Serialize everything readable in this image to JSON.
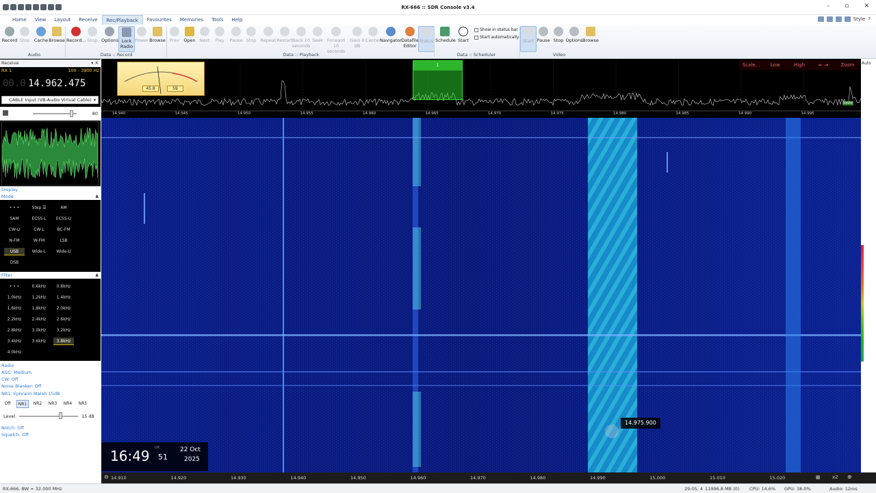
{
  "window": {
    "title": "RX-666 :: SDR Console v3.4",
    "style_label": "Style"
  },
  "menu": [
    "Home",
    "View",
    "Layout",
    "Receive",
    "Rec/Playback",
    "Favourites",
    "Memories",
    "Tools",
    "Help"
  ],
  "ribbon": {
    "audio": {
      "record": "Record",
      "stop": "Stop",
      "cache": "Cache",
      "browse": "Browse",
      "group": "Audio"
    },
    "record": {
      "record": "Record...",
      "stop": "Stop",
      "options": "Options",
      "lock_radio": "Lock Radio",
      "power": "Power",
      "browse": "Browse",
      "group": "Data :: Record"
    },
    "playback": {
      "prev": "Prev",
      "open": "Open",
      "next": "Next",
      "play": "Play",
      "pause": "Pause",
      "stop": "Stop",
      "repeat": "Repeat",
      "restart": "Restart",
      "back10": "Back 10 seconds",
      "seek": "Seek",
      "forward10": "Forward 10 seconds",
      "gain": "Gain 0 dB",
      "center": "Center",
      "navigator": "Navigator",
      "datafile_editor": "Datafile Editor",
      "status": "Status",
      "group": "Data :: Playback"
    },
    "scheduler": {
      "schedule": "Schedule",
      "start": "Start",
      "show_status": "Show in status bar",
      "start_auto": "Start automatically",
      "group": "Data :: Scheduler"
    },
    "video": {
      "start": "Start",
      "pause": "Pause",
      "stop": "Stop",
      "options": "Options",
      "browse": "Browse",
      "group": "Video"
    }
  },
  "receive": {
    "header": "Receive",
    "rx": "RX 1",
    "range": "100 - 3900 Hz",
    "freq_dim": "00.0",
    "freq_main": "14.962.475",
    "source": "CABLE Input (VB-Audio Virtual Cable)",
    "volume": "80"
  },
  "display_section": "Display",
  "mode": {
    "title": "Mode",
    "buttons": [
      "• • •",
      "Step ☰",
      "AM",
      "SAM",
      "ECSS-L",
      "ECSS-U",
      "CW-U",
      "CW-L",
      "BC-FM",
      "N-FM",
      "W-FM",
      "LSB",
      "USB",
      "Wide-L",
      "Wide-U",
      "DSB"
    ],
    "selected": "USB"
  },
  "filter": {
    "title": "Filter",
    "buttons": [
      "• • •",
      "0.6kHz",
      "0.8kHz",
      "1.0kHz",
      "1.2kHz",
      "1.4kHz",
      "1.6kHz",
      "1.8kHz",
      "2.0kHz",
      "2.2kHz",
      "2.4kHz",
      "2.6kHz",
      "2.8kHz",
      "3.0kHz",
      "3.2kHz",
      "3.4kHz",
      "3.6kHz",
      "3.8kHz",
      "4.0kHz"
    ],
    "selected": "3.8kHz"
  },
  "radio": {
    "title": "Radio",
    "agc": "AGC: Medium",
    "cw": "CW: Off",
    "noise_blanker": "Noise Blanker: Off",
    "nr": "NR1: Ephraim Malah 15dB",
    "nr_buttons": [
      "Off",
      "NR1",
      "NR2",
      "NR3",
      "NR4",
      "NR5"
    ],
    "nr_selected": "NR1",
    "level_label": "Level",
    "level_value": "15 dB",
    "notch": "Notch: Off",
    "squelch": "Squelch: Off"
  },
  "spectrum": {
    "ticks": [
      "14.940",
      "14.945",
      "14.950",
      "14.955",
      "14.960",
      "14.965",
      "14.970",
      "14.975",
      "14.980",
      "14.985",
      "14.990",
      "14.995"
    ],
    "scale_buttons": [
      "Scale...",
      "Low",
      "High",
      "⇤ ⇥",
      "Zoom"
    ],
    "auto": "Auto",
    "meter_left": "45.8",
    "meter_right": "S9",
    "marker_label": "1",
    "right_badge": "RWM"
  },
  "waterfall": {
    "ticks": [
      "14.910",
      "14.920",
      "14.930",
      "14.940",
      "14.950",
      "14.960",
      "14.970",
      "14.980",
      "14.990",
      "15.000",
      "15.010",
      "15.020"
    ],
    "tooltip": "14.975.900",
    "zoom": "x2"
  },
  "clock": {
    "time": "16:49",
    "seconds": "51",
    "utc": "UTC",
    "date": "22 Oct",
    "year": "2025"
  },
  "status": {
    "left": "RX-666, BW = 32.000 MHz",
    "time": "29:05, 4",
    "memory": "11996.8 MB (0)",
    "cpu": "CPU: 14.6%",
    "gpu": "GPU: 38.0%",
    "audio": "Audio: 12ms"
  },
  "colors": {
    "accent": "#2c7ad6",
    "waterfall_bg": "#0a1a7a",
    "marker": "#2db52d"
  }
}
